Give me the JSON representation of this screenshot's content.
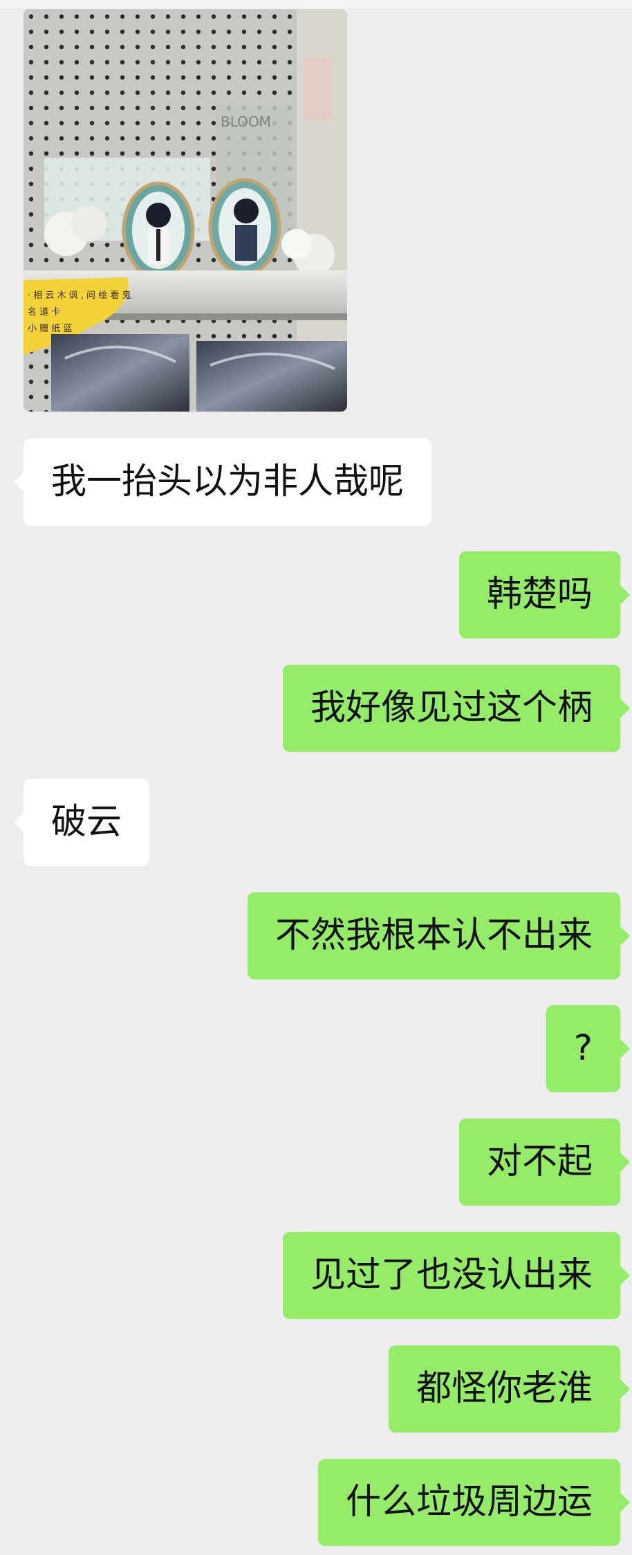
{
  "chat": {
    "photo_alt": "shelf-photo",
    "photo_note_line1": "· 相 云 木 讽 , 问 绘 看 鬼",
    "photo_note_line2": "名 道 卡",
    "photo_note_line3": "小 赠 纸 蓝",
    "messages": [
      {
        "side": "left",
        "text": "我一抬头以为非人哉呢"
      },
      {
        "side": "right",
        "text": "韩楚吗"
      },
      {
        "side": "right",
        "text": "我好像见过这个柄"
      },
      {
        "side": "left",
        "text": "破云"
      },
      {
        "side": "right",
        "text": "不然我根本认不出来"
      },
      {
        "side": "right",
        "text": "?"
      },
      {
        "side": "right",
        "text": "对不起"
      },
      {
        "side": "right",
        "text": "见过了也没认出来"
      },
      {
        "side": "right",
        "text": "都怪你老淮"
      },
      {
        "side": "right",
        "text": "什么垃圾周边运"
      }
    ]
  },
  "colors": {
    "background": "#ededed",
    "sent_bubble": "#95ec69",
    "received_bubble": "#ffffff"
  }
}
